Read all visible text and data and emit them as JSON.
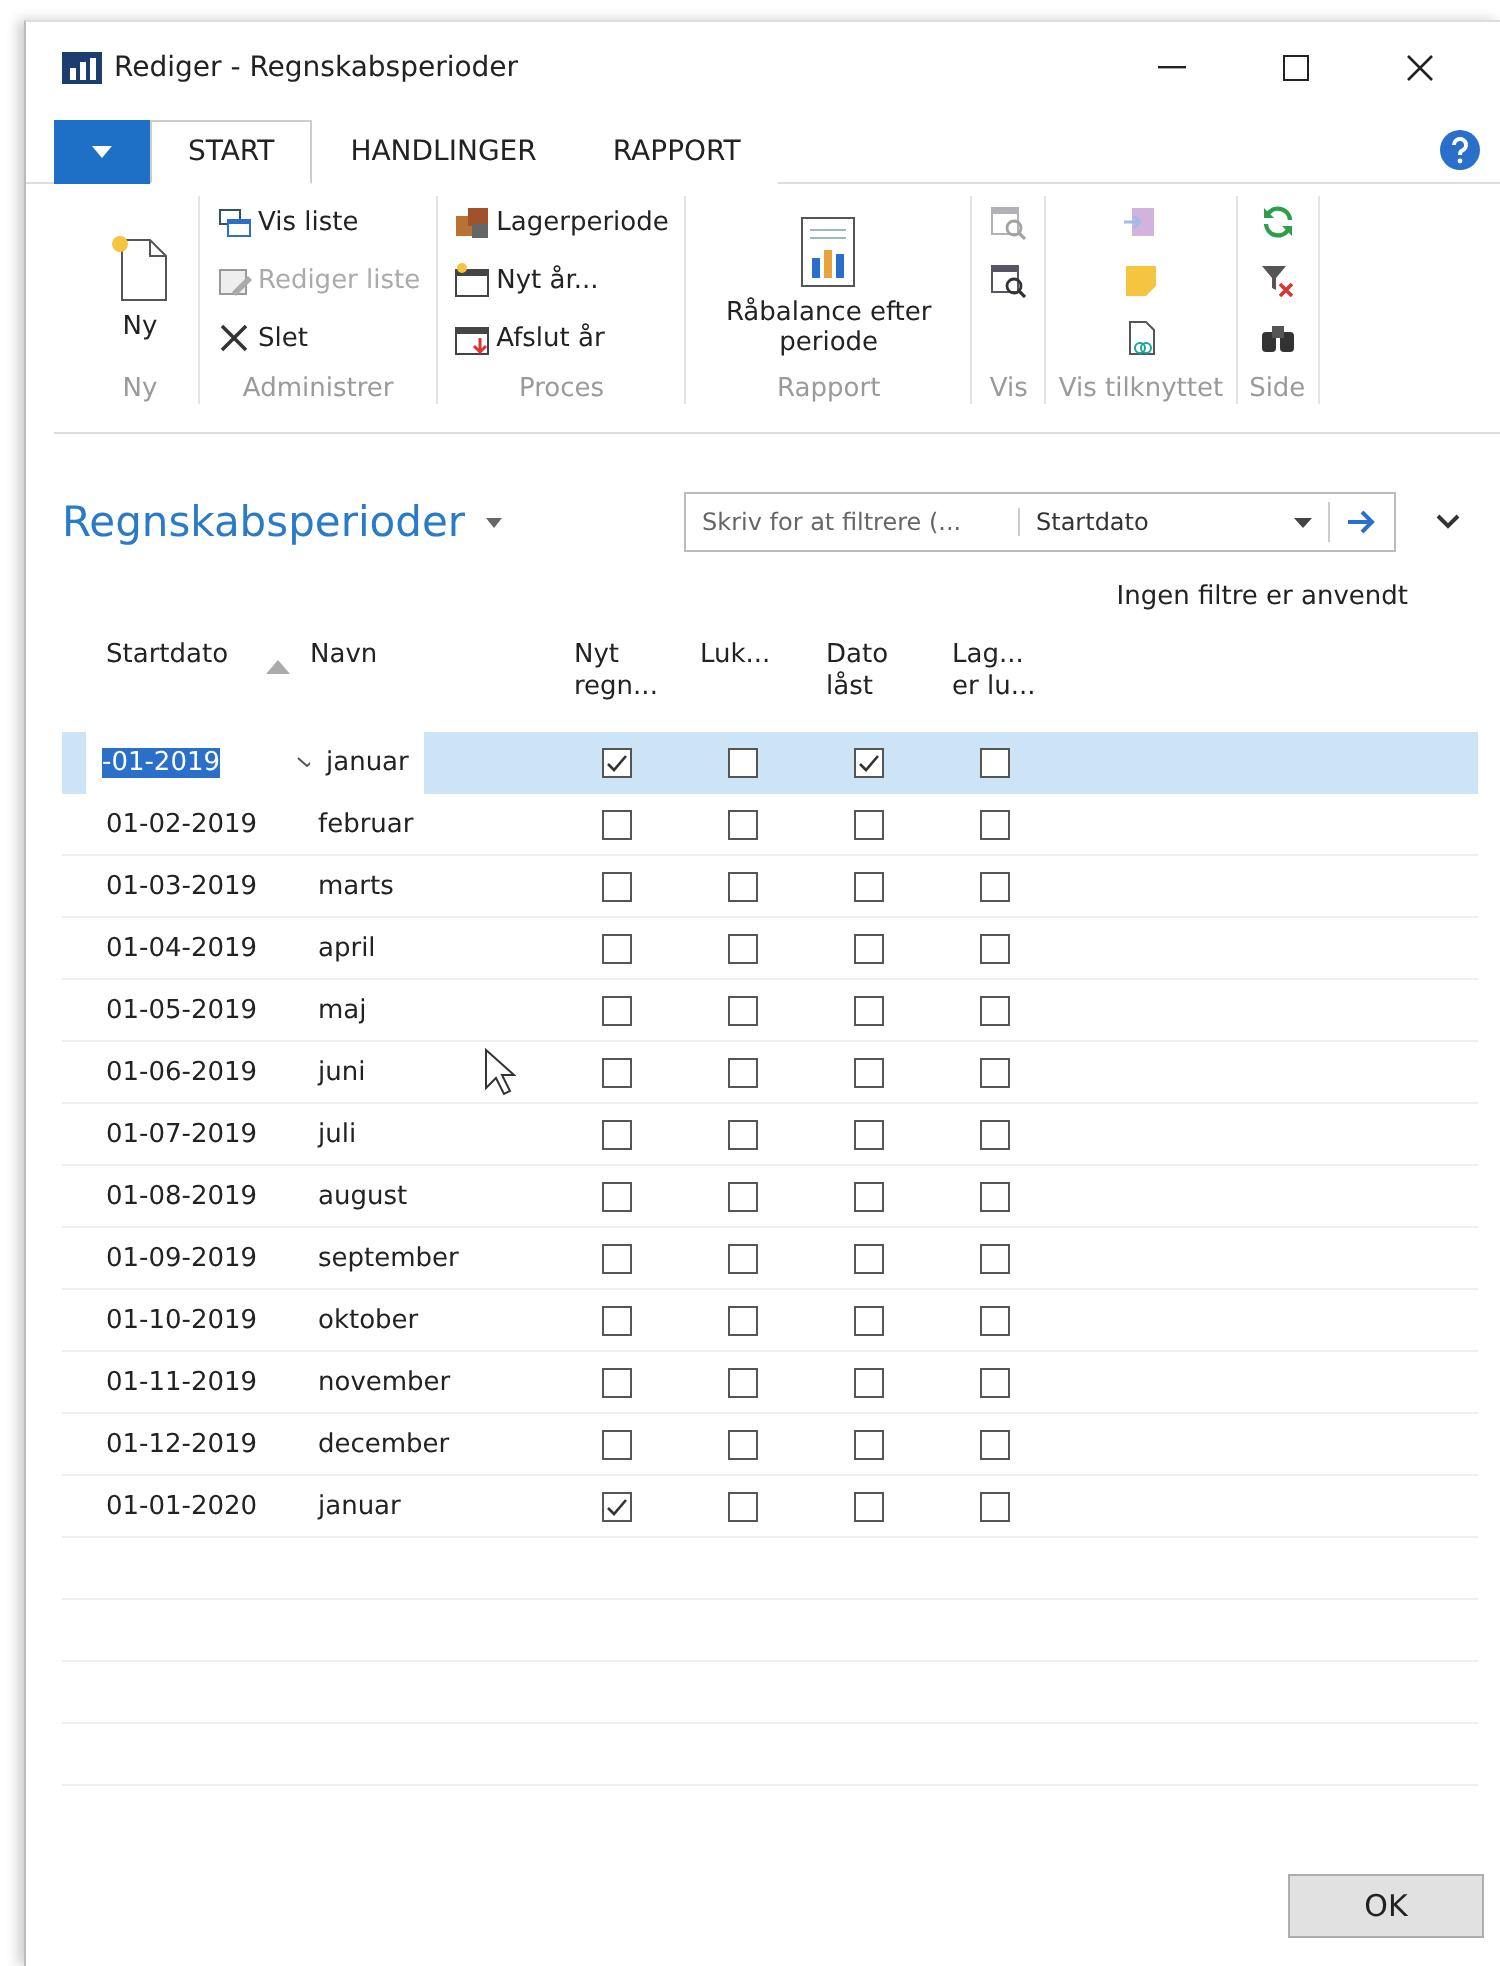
{
  "window": {
    "title": "Rediger - Regnskabsperioder"
  },
  "ribbon_tabs": [
    {
      "label": "START",
      "selected": true
    },
    {
      "label": "HANDLINGER",
      "selected": false
    },
    {
      "label": "RAPPORT",
      "selected": false
    }
  ],
  "ribbon_groups": [
    {
      "label": "Ny",
      "items": [
        {
          "kind": "large",
          "label": "Ny",
          "disabled": false
        }
      ]
    },
    {
      "label": "Administrer",
      "items": [
        {
          "kind": "small",
          "label": "Vis liste",
          "disabled": false
        },
        {
          "kind": "small",
          "label": "Rediger liste",
          "disabled": true
        },
        {
          "kind": "small",
          "label": "Slet",
          "disabled": false
        }
      ]
    },
    {
      "label": "Proces",
      "items": [
        {
          "kind": "small",
          "label": "Lagerperiode",
          "disabled": false
        },
        {
          "kind": "small",
          "label": "Nyt år...",
          "disabled": false
        },
        {
          "kind": "small",
          "label": "Afslut år",
          "disabled": false
        }
      ]
    },
    {
      "label": "Rapport",
      "items": [
        {
          "kind": "large",
          "label": "Råbalance efter periode",
          "disabled": false
        }
      ]
    },
    {
      "label": "Vis",
      "items": [
        {
          "kind": "icon",
          "disabled": true
        },
        {
          "kind": "icon",
          "disabled": false
        }
      ]
    },
    {
      "label": "Vis tilknyttet",
      "items": [
        {
          "kind": "icon",
          "disabled": true
        },
        {
          "kind": "icon",
          "disabled": false
        },
        {
          "kind": "icon",
          "disabled": false
        }
      ]
    },
    {
      "label": "Side",
      "items": [
        {
          "kind": "icon",
          "disabled": false
        },
        {
          "kind": "icon",
          "disabled": false
        },
        {
          "kind": "icon",
          "disabled": false
        }
      ]
    }
  ],
  "page": {
    "title": "Regnskabsperioder",
    "filter": {
      "placeholder": "Skriv for at filtrere (...",
      "field": "Startdato"
    },
    "filter_note": "Ingen filtre er anvendt"
  },
  "table": {
    "columns": [
      "Startdato",
      "Navn",
      "Nyt regn...",
      "Luk...",
      "Dato låst",
      "Lag... er lu..."
    ],
    "rows": [
      {
        "start": "-01-2019",
        "name": "januar",
        "checks": [
          true,
          false,
          true,
          false
        ],
        "selected": true
      },
      {
        "start": "01-02-2019",
        "name": "februar",
        "checks": [
          false,
          false,
          false,
          false
        ],
        "selected": false
      },
      {
        "start": "01-03-2019",
        "name": "marts",
        "checks": [
          false,
          false,
          false,
          false
        ],
        "selected": false
      },
      {
        "start": "01-04-2019",
        "name": "april",
        "checks": [
          false,
          false,
          false,
          false
        ],
        "selected": false
      },
      {
        "start": "01-05-2019",
        "name": "maj",
        "checks": [
          false,
          false,
          false,
          false
        ],
        "selected": false
      },
      {
        "start": "01-06-2019",
        "name": "juni",
        "checks": [
          false,
          false,
          false,
          false
        ],
        "selected": false
      },
      {
        "start": "01-07-2019",
        "name": "juli",
        "checks": [
          false,
          false,
          false,
          false
        ],
        "selected": false
      },
      {
        "start": "01-08-2019",
        "name": "august",
        "checks": [
          false,
          false,
          false,
          false
        ],
        "selected": false
      },
      {
        "start": "01-09-2019",
        "name": "september",
        "checks": [
          false,
          false,
          false,
          false
        ],
        "selected": false
      },
      {
        "start": "01-10-2019",
        "name": "oktober",
        "checks": [
          false,
          false,
          false,
          false
        ],
        "selected": false
      },
      {
        "start": "01-11-2019",
        "name": "november",
        "checks": [
          false,
          false,
          false,
          false
        ],
        "selected": false
      },
      {
        "start": "01-12-2019",
        "name": "december",
        "checks": [
          false,
          false,
          false,
          false
        ],
        "selected": false
      },
      {
        "start": "01-01-2020",
        "name": "januar",
        "checks": [
          true,
          false,
          false,
          false
        ],
        "selected": false
      }
    ]
  },
  "buttons": [
    "OK"
  ]
}
